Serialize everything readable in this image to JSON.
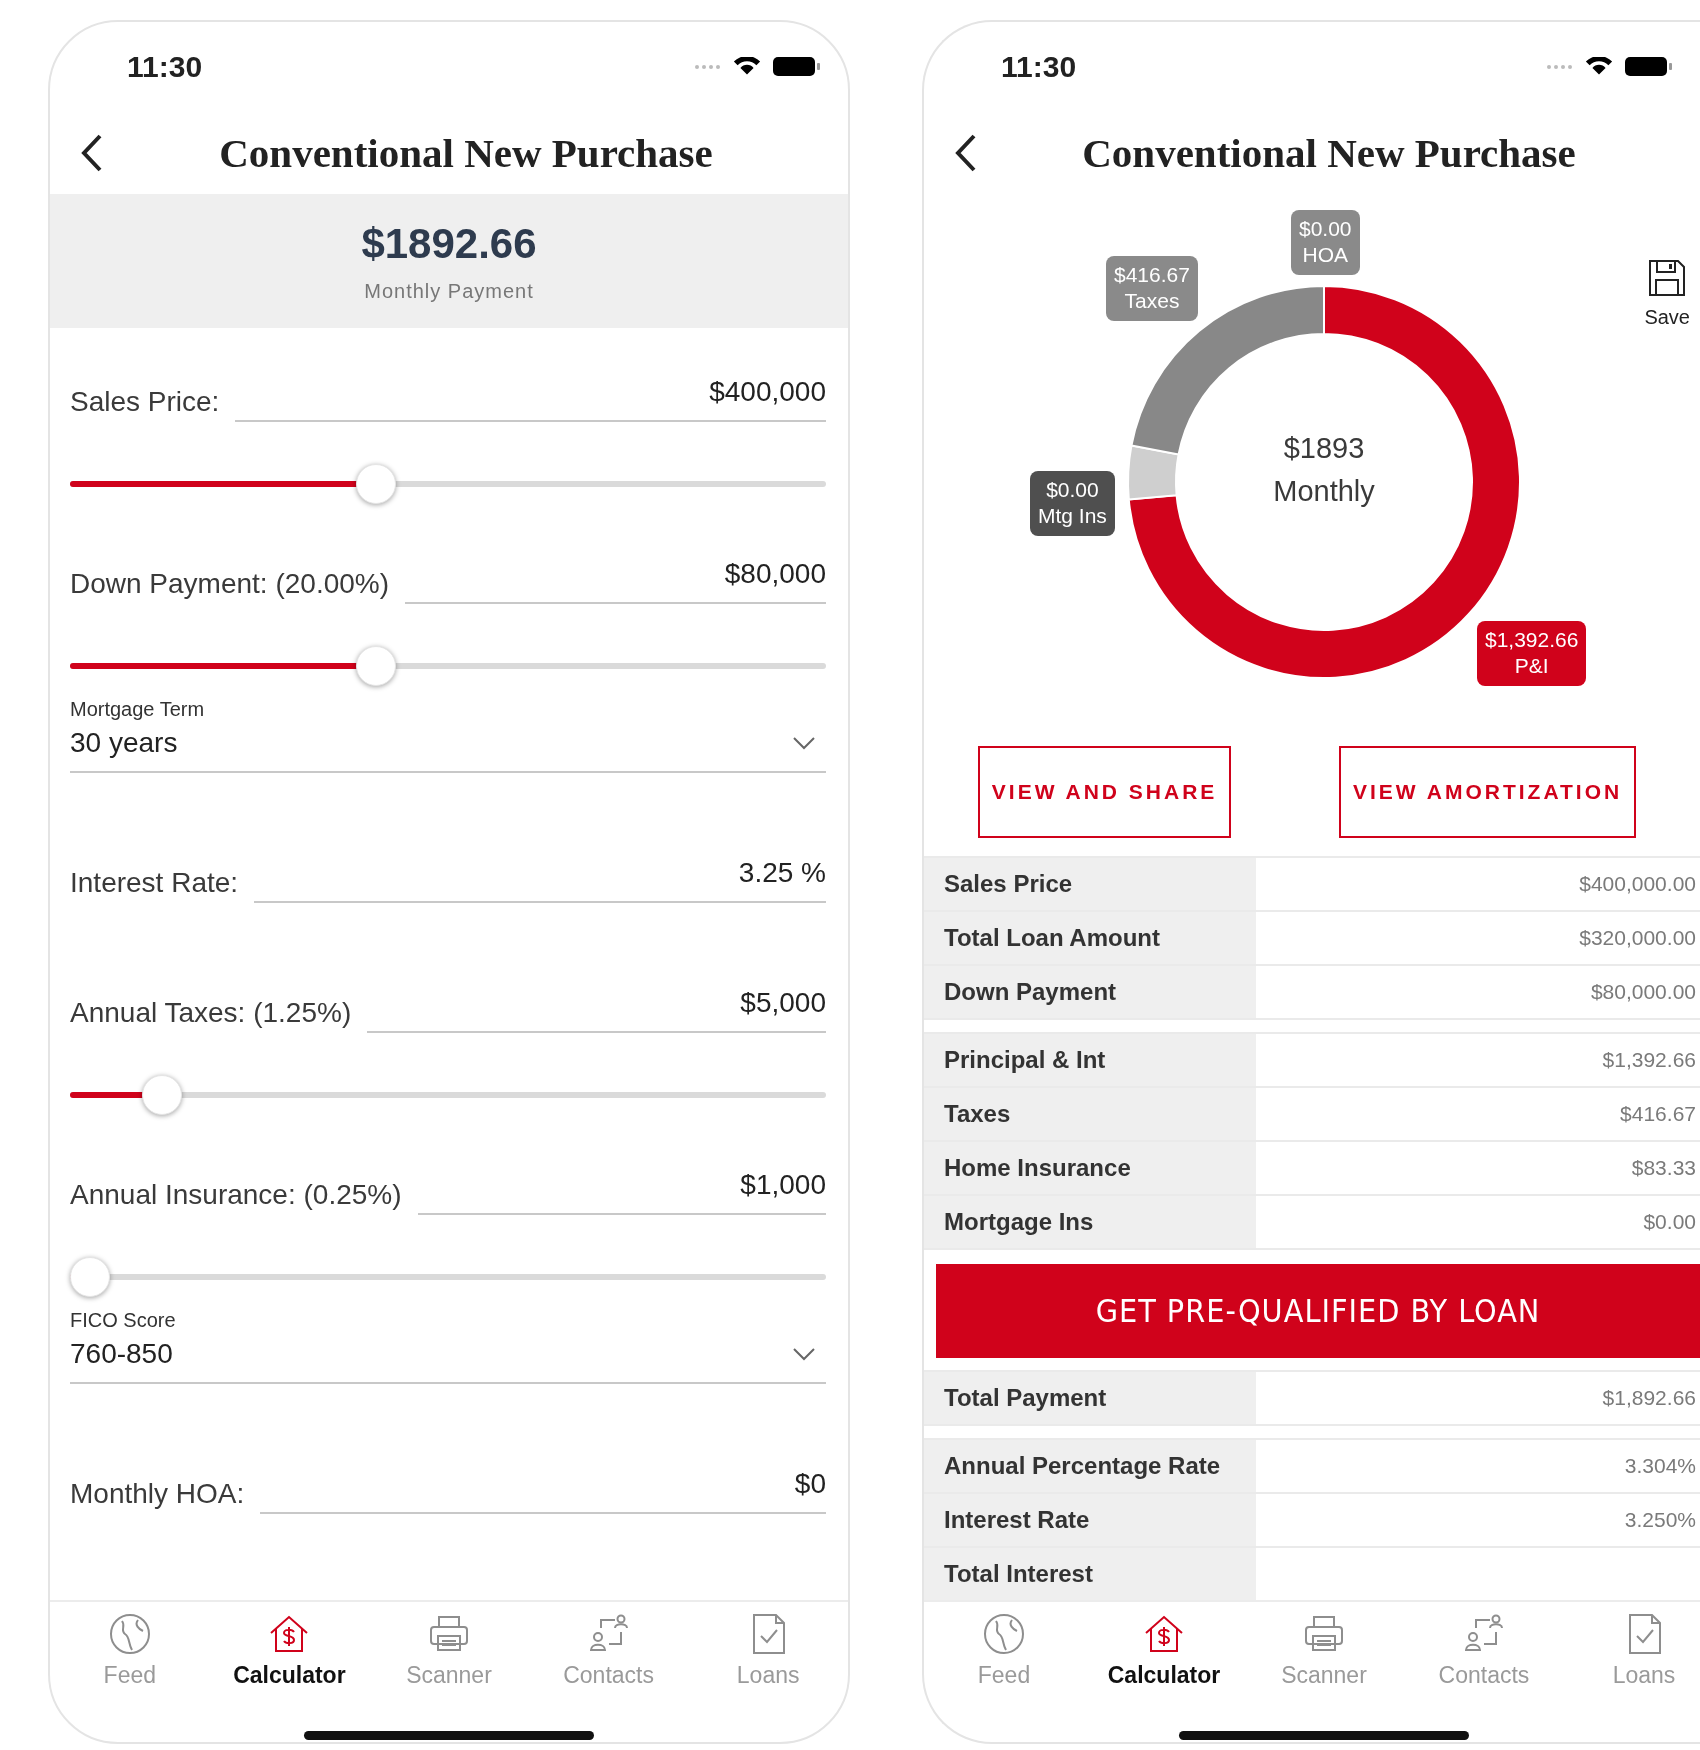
{
  "calculator_screen": {
    "status_bar": {
      "time": "11:30"
    },
    "title": "Conventional New Purchase",
    "summary": {
      "amount": "$1892.66",
      "label": "Monthly Payment"
    },
    "fields": [
      {
        "kind": "text",
        "label": "Sales Price:",
        "value": "$400,000"
      },
      {
        "kind": "slider",
        "level": 0.4
      },
      {
        "kind": "text",
        "label": "Down Payment: (20.00%)",
        "value": "$80,000"
      },
      {
        "kind": "slider",
        "level": 0.4
      },
      {
        "kind": "select",
        "label": "Mortgage Term",
        "value": "30 years"
      },
      {
        "kind": "text",
        "label": "Interest Rate:",
        "value": "3.25 %"
      },
      {
        "kind": "text",
        "label": "Annual Taxes: (1.25%)",
        "value": "$5,000"
      },
      {
        "kind": "slider",
        "level": 0.1
      },
      {
        "kind": "text",
        "label": "Annual Insurance: (0.25%)",
        "value": "$1,000"
      },
      {
        "kind": "slider",
        "level": 0
      },
      {
        "kind": "select",
        "label": "FICO Score",
        "value": "760-850"
      },
      {
        "kind": "text",
        "label": "Monthly HOA:",
        "value": "$0"
      }
    ],
    "tab_bar": [
      {
        "kind": "feed",
        "label": "Feed",
        "selected": false
      },
      {
        "kind": "calculator",
        "label": "Calculator",
        "selected": true
      },
      {
        "kind": "scanner",
        "label": "Scanner",
        "selected": false
      },
      {
        "kind": "contacts",
        "label": "Contacts",
        "selected": false
      },
      {
        "kind": "loans",
        "label": "Loans",
        "selected": false
      }
    ]
  },
  "summary_screen": {
    "status_bar": {
      "time": "11:30"
    },
    "title": "Conventional New Purchase",
    "chart": {
      "center_amount": "$1893",
      "center_label": "Monthly",
      "chart_data": {
        "type": "donut",
        "values": [
          73.58,
          4.4,
          22.02
        ],
        "colors": [
          "#d0021b",
          "#cfcfcf",
          "#888888"
        ]
      },
      "callouts": [
        {
          "amount": "$0.00",
          "label": "HOA",
          "color": "#8a8a8a"
        },
        {
          "amount": "$416.67",
          "label": "Taxes",
          "color": "#8a8a8a"
        },
        {
          "amount": "$0.00",
          "label": "Mtg Ins",
          "color": "#4f4f4f"
        },
        {
          "amount": "$1,392.66",
          "label": "P&I",
          "color": "#d0021b"
        }
      ]
    },
    "save": {
      "label": "Save"
    },
    "buttons": [
      "VIEW AND SHARE",
      "VIEW AMORTIZATION"
    ],
    "sections": [
      {
        "kind": "rows",
        "rows": [
          {
            "label": "Sales Price",
            "value": "$400,000.00"
          },
          {
            "label": "Total Loan Amount",
            "value": "$320,000.00"
          },
          {
            "label": "Down Payment",
            "value": "$80,000.00"
          }
        ]
      },
      {
        "kind": "rows",
        "rows": [
          {
            "label": "Principal & Int",
            "value": "$1,392.66"
          },
          {
            "label": "Taxes",
            "value": "$416.67"
          },
          {
            "label": "Home Insurance",
            "value": "$83.33"
          },
          {
            "label": "Mortgage Ins",
            "value": "$0.00"
          }
        ]
      },
      {
        "kind": "cta",
        "label": "GET PRE-QUALIFIED BY LOAN"
      },
      {
        "kind": "rows",
        "rows": [
          {
            "label": "Total Payment",
            "value": "$1,892.66"
          }
        ]
      },
      {
        "kind": "rows",
        "rows": [
          {
            "label": "Annual Percentage Rate",
            "value": "3.304%"
          },
          {
            "label": "Interest Rate",
            "value": "3.250%"
          },
          {
            "label": "Total Interest"
          }
        ]
      }
    ],
    "tab_bar": [
      {
        "kind": "feed",
        "label": "Feed",
        "selected": false
      },
      {
        "kind": "calculator",
        "label": "Calculator",
        "selected": true
      },
      {
        "kind": "scanner",
        "label": "Scanner",
        "selected": false
      },
      {
        "kind": "contacts",
        "label": "Contacts",
        "selected": false
      },
      {
        "kind": "loans",
        "label": "Loans",
        "selected": false
      }
    ]
  }
}
